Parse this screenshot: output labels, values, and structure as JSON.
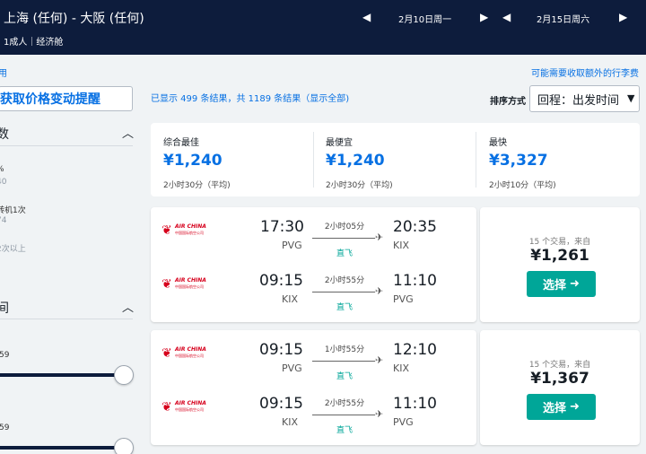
{
  "header": {
    "route": "上海 (任何) - 大阪 (任何)",
    "passengers": "1成人｜经济舱",
    "depart_date": "2月10日周一",
    "return_date": "2月15日周六"
  },
  "left_link": "用",
  "fee_note": "可能需要收取额外的行李费",
  "price_alert": "获取价格变动提醒",
  "results": {
    "count_text": "已显示 499 条结果，共 1189 条结果（显示全部)",
    "sort_label": "排序方式",
    "sort_value": "回程：出发时间"
  },
  "sidebar": {
    "stops_title": "数",
    "stops_option1": "%",
    "stops_option1_price": "40",
    "stops_option2": "转机1次",
    "stops_option2_price": "74",
    "stops_option3": "2次以上",
    "time_title": "间",
    "slider1_label": ":59",
    "slider2_label": ":59"
  },
  "summary": [
    {
      "label": "综合最佳",
      "price": "¥1,240",
      "duration": "2小时30分（平均)"
    },
    {
      "label": "最便宜",
      "price": "¥1,240",
      "duration": "2小时30分（平均)"
    },
    {
      "label": "最快",
      "price": "¥3,327",
      "duration": "2小时10分（平均)"
    }
  ],
  "airline": {
    "name": "AIR CHINA",
    "sub": "中国国际航空公司"
  },
  "cards": [
    {
      "outbound": {
        "depart": "17:30",
        "from": "PVG",
        "duration": "2小时05分",
        "stops": "直飞",
        "arrive": "20:35",
        "to": "KIX"
      },
      "inbound": {
        "depart": "09:15",
        "from": "KIX",
        "duration": "2小时55分",
        "stops": "直飞",
        "arrive": "11:10",
        "to": "PVG"
      },
      "deals": "15 个交易，来自",
      "price": "¥1,261",
      "select": "选择"
    },
    {
      "outbound": {
        "depart": "09:15",
        "from": "PVG",
        "duration": "1小时55分",
        "stops": "直飞",
        "arrive": "12:10",
        "to": "KIX"
      },
      "inbound": {
        "depart": "09:15",
        "from": "KIX",
        "duration": "2小时55分",
        "stops": "直飞",
        "arrive": "11:10",
        "to": "PVG"
      },
      "deals": "15 个交易，来自",
      "price": "¥1,367",
      "select": "选择"
    }
  ]
}
